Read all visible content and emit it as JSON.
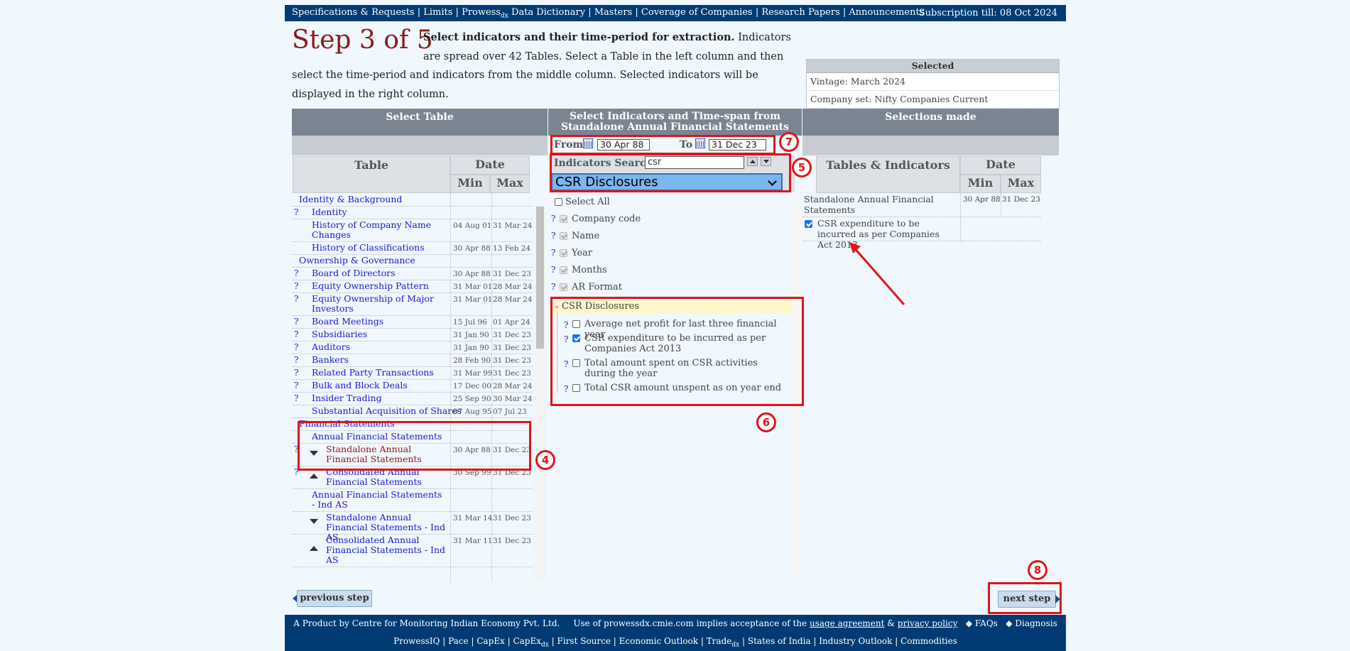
{
  "topbar": {
    "nav": [
      "Specifications & Requests",
      "Limits",
      "Prowess",
      "Data Dictionary",
      "Masters",
      "Coverage of Companies",
      "Research Papers",
      "Announcements"
    ],
    "prowess_sub": "dx",
    "subscription": "Subscription till: 08 Oct 2024"
  },
  "step": {
    "title": "Step 3 of 5",
    "lead": "Select indicators and their time-period for extraction.",
    "body": " Indicators are spread over 42 Tables. Select a Table in the left column and then select the time-period and indicators from the middle column. Selected indicators will be displayed in the right column."
  },
  "selected_box": {
    "header": "Selected",
    "vintage": "Vintage: March 2024",
    "company_set": "Company set: Nifty Companies Current"
  },
  "columns": {
    "left": "Select Table",
    "middle": "Select Indicators and Time-span from Standalone Annual Financial Statements",
    "right": "Selections made"
  },
  "left_table": {
    "col_table": "Table",
    "col_date": "Date",
    "col_min": "Min",
    "col_max": "Max",
    "group_identity": "Identity & Background",
    "group_ownership": "Ownership & Governance",
    "group_financial": "Financial Statements",
    "subgroup_afs": "Annual Financial Statements",
    "subgroup_afs_indas": "Annual Financial Statements - Ind AS",
    "rows": [
      {
        "name": "Identity",
        "min": "",
        "max": ""
      },
      {
        "name": "History of Company Name Changes",
        "min": "04 Aug 01",
        "max": "31 Mar 24"
      },
      {
        "name": "History of Classifications",
        "min": "30 Apr 88",
        "max": "13 Feb 24"
      },
      {
        "name": "Board of Directors",
        "min": "30 Apr 88",
        "max": "31 Dec 23"
      },
      {
        "name": "Equity Ownership Pattern",
        "min": "31 Mar 01",
        "max": "28 Mar 24"
      },
      {
        "name": "Equity Ownership of Major Investors",
        "min": "31 Mar 01",
        "max": "28 Mar 24"
      },
      {
        "name": "Board Meetings",
        "min": "15 Jul 96",
        "max": "01 Apr 24"
      },
      {
        "name": "Subsidiaries",
        "min": "31 Jan 90",
        "max": "31 Dec 23"
      },
      {
        "name": "Auditors",
        "min": "31 Jan 90",
        "max": "31 Dec 23"
      },
      {
        "name": "Bankers",
        "min": "28 Feb 90",
        "max": "31 Dec 23"
      },
      {
        "name": "Related Party Transactions",
        "min": "31 Mar 99",
        "max": "31 Dec 23"
      },
      {
        "name": "Bulk and Block Deals",
        "min": "17 Dec 00",
        "max": "28 Mar 24"
      },
      {
        "name": "Insider Trading",
        "min": "25 Sep 90",
        "max": "30 Mar 24"
      },
      {
        "name": "Substantial Acquisition of Shares",
        "min": "07 Aug 95",
        "max": "07 Jul 23"
      },
      {
        "name": "Standalone Annual Financial Statements",
        "min": "30 Apr 88",
        "max": "31 Dec 23"
      },
      {
        "name": "Consolidated Annual Financial Statements",
        "min": "30 Sep 99",
        "max": "31 Dec 23"
      },
      {
        "name": "Standalone Annual Financial Statements - Ind AS",
        "min": "31 Mar 14",
        "max": "31 Dec 23"
      },
      {
        "name": "Consolidated Annual Financial Statements - Ind AS",
        "min": "31 Mar 11",
        "max": "31 Dec 23"
      }
    ]
  },
  "middle": {
    "from_label": "From",
    "from_value": "30 Apr 88",
    "to_label": "To",
    "to_value": "31 Dec 23",
    "search_label": "Indicators Search:",
    "search_value": "csr",
    "dropdown_value": "CSR Disclosures",
    "select_all": "Select All",
    "fixed_fields": [
      "Company code",
      "Name",
      "Year",
      "Months",
      "AR Format"
    ],
    "group": "CSR Disclosures",
    "indicators": [
      {
        "label": "Average net profit for last three financial year",
        "checked": false
      },
      {
        "label": "CSR expenditure to be incurred as per Companies Act 2013",
        "checked": true
      },
      {
        "label": "Total amount spent on CSR activities during the year",
        "checked": false
      },
      {
        "label": "Total CSR amount unspent as on year end",
        "checked": false
      }
    ]
  },
  "right": {
    "col_tables": "Tables & Indicators",
    "col_date": "Date",
    "col_min": "Min",
    "col_max": "Max",
    "table_name": "Standalone Annual Financial Statements",
    "table_min": "30 Apr 88",
    "table_max": "31 Dec 23",
    "indicator": "CSR expenditure to be incurred as per Companies Act 2013"
  },
  "annotations": [
    "4",
    "5",
    "6",
    "7",
    "8"
  ],
  "buttons": {
    "previous": "previous step",
    "next": "next step"
  },
  "footer": {
    "line1_a": "A Product by Centre for Monitoring Indian Economy Pvt. Ltd.",
    "line1_b": "Use of prowessdx.cmie.com implies acceptance of the",
    "agreement": "usage agreement",
    "amp": "&",
    "privacy": "privacy policy",
    "faqs": "FAQs",
    "diagnosis": "Diagnosis",
    "products": [
      "ProwessIQ",
      "Pace",
      "CapEx",
      "CapEx",
      "First Source",
      "Economic Outlook",
      "Trade",
      "States of India",
      "Industry Outlook",
      "Commodities"
    ],
    "product_sub": "dx"
  }
}
